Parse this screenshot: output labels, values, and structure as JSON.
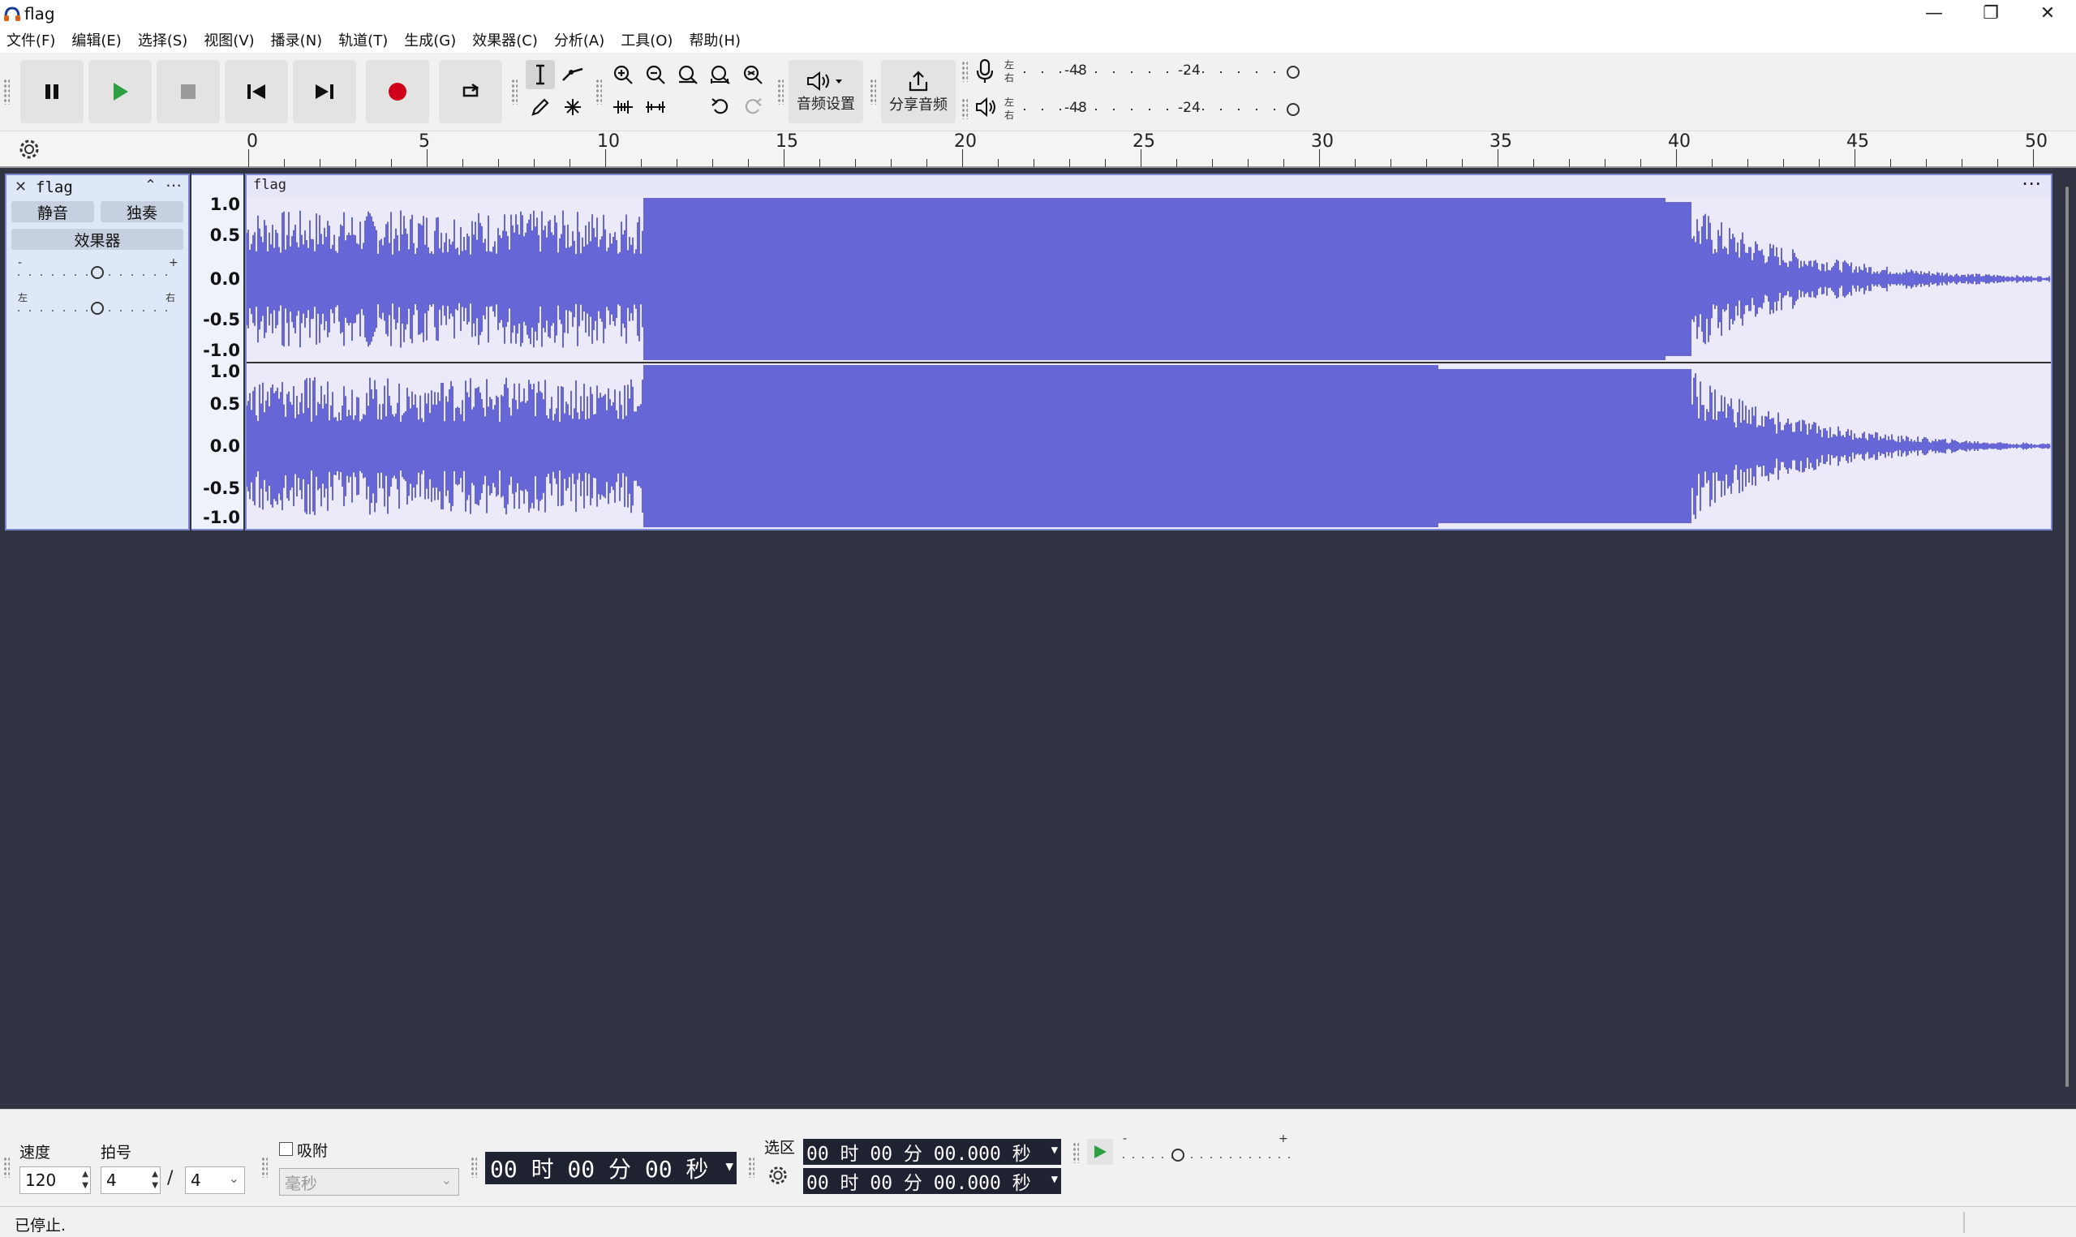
{
  "window": {
    "title": "flag",
    "min_glyph": "—",
    "max_glyph": "❐",
    "close_glyph": "✕"
  },
  "menu": [
    "文件(F)",
    "编辑(E)",
    "选择(S)",
    "视图(V)",
    "播录(N)",
    "轨道(T)",
    "生成(G)",
    "效果器(C)",
    "分析(A)",
    "工具(O)",
    "帮助(H)"
  ],
  "toolbar": {
    "audio_setup_label": "音频设置",
    "share_audio_label": "分享音频",
    "meter_ticks": [
      "-48",
      "-24"
    ],
    "meter_lr": [
      "左",
      "右"
    ]
  },
  "ruler": {
    "ticks": [
      "0",
      "5",
      "10",
      "15",
      "20",
      "25",
      "30",
      "35",
      "40",
      "45",
      "50"
    ]
  },
  "track": {
    "name": "flag",
    "mute_label": "静音",
    "solo_label": "独奏",
    "effects_label": "效果器",
    "gain_minus": "-",
    "gain_plus": "+",
    "pan_left": "左",
    "pan_right": "右",
    "clip_name": "flag",
    "scale_top": [
      "1.0",
      "0.5",
      "0.0",
      "-0.5",
      "-1.0"
    ],
    "scale_bottom": [
      "1.0",
      "0.5",
      "0.0",
      "-0.5",
      "-1.0"
    ]
  },
  "bottom": {
    "tempo_label": "速度",
    "tempo_value": "120",
    "timesig_label": "拍号",
    "timesig_num": "4",
    "timesig_sep": "/",
    "timesig_den": "4",
    "snap_label": "吸附",
    "snap_unit": "毫秒",
    "time_display": "00 时 00 分 00 秒",
    "selection_label": "选区",
    "sel_start": "00 时 00 分 00.000 秒",
    "sel_end": "00 时 00 分 00.000 秒",
    "play_speed_minus": "-",
    "play_speed_plus": "+"
  },
  "status": {
    "text": "已停止."
  },
  "colors": {
    "waveform": "#6666d6",
    "clip_bg": "#eceaf9",
    "track_panel": "#dfe8f8",
    "empty_area": "#2f3342",
    "record": "#d0021b",
    "play": "#2ea043"
  },
  "icons": [
    "pause-icon",
    "play-icon",
    "stop-icon",
    "skip-start-icon",
    "skip-end-icon",
    "record-icon",
    "loop-icon",
    "select-tool-icon",
    "envelope-tool-icon",
    "draw-tool-icon",
    "multi-tool-icon",
    "zoom-in-icon",
    "zoom-out-icon",
    "fit-selection-icon",
    "fit-project-icon",
    "zoom-toggle-icon",
    "trim-icon",
    "silence-icon",
    "undo-icon",
    "redo-icon",
    "speaker-icon",
    "share-icon",
    "microphone-icon",
    "gear-icon"
  ]
}
